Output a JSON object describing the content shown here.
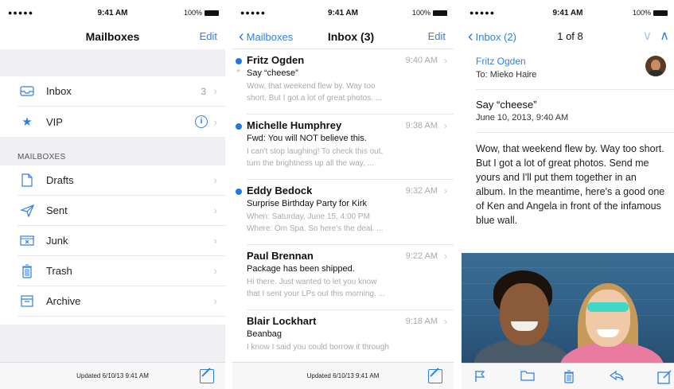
{
  "colors": {
    "accent": "#2f7fe0",
    "unread_dot": "#1f7ae8",
    "group_bg": "#efeff4"
  },
  "statusbar": {
    "carrier": "●●●●● ",
    "time": "9:41 AM",
    "battery": "100%"
  },
  "screen1": {
    "nav": {
      "title": "Mailboxes",
      "edit": "Edit"
    },
    "top_items": [
      {
        "icon": "inbox-icon",
        "label": "Inbox",
        "count": "3"
      },
      {
        "icon": "star-icon",
        "label": "VIP",
        "info": "i"
      }
    ],
    "section_header": "MAILBOXES",
    "items": [
      {
        "icon": "drafts-icon",
        "label": "Drafts"
      },
      {
        "icon": "sent-icon",
        "label": "Sent"
      },
      {
        "icon": "junk-icon",
        "label": "Junk"
      },
      {
        "icon": "trash-icon",
        "label": "Trash"
      },
      {
        "icon": "archive-icon",
        "label": "Archive"
      }
    ],
    "updated": "Updated 6/10/13 9:41 AM"
  },
  "screen2": {
    "nav": {
      "back": "Mailboxes",
      "title": "Inbox (3)",
      "edit": "Edit"
    },
    "messages": [
      {
        "from": "Fritz Ogden",
        "time": "9:40 AM",
        "subject": "Say “cheese”",
        "preview1": "Wow, that weekend flew by. Way too",
        "preview2": "short. But I got a lot of great photos. ...",
        "unread": true,
        "attachment": true
      },
      {
        "from": "Michelle Humphrey",
        "time": "9:38 AM",
        "subject": "Fwd: You will NOT believe this.",
        "preview1": "I can't stop laughing! To check this out,",
        "preview2": "turn the brightness up all the way, ...",
        "unread": true
      },
      {
        "from": "Eddy Bedock",
        "time": "9:32 AM",
        "subject": "Surprise Birthday Party for Kirk",
        "preview1": "When: Saturday, June 15, 4:00 PM",
        "preview2": "Where: Om Spa. So here's the deal. ...",
        "unread": true
      },
      {
        "from": "Paul Brennan",
        "time": "9:22 AM",
        "subject": "Package has been shipped.",
        "preview1": "Hi there. Just wanted to let you know",
        "preview2": "that I sent your LPs out this morning. ...",
        "unread": false
      },
      {
        "from": "Blair Lockhart",
        "time": "9:18 AM",
        "subject": "Beanbag",
        "preview1": "I know I said you could borrow it through",
        "preview2": "",
        "unread": false
      }
    ],
    "updated": "Updated 6/10/13 9:41 AM"
  },
  "screen3": {
    "nav": {
      "back": "Inbox (2)",
      "counter": "1 of 8"
    },
    "from": "Fritz Ogden",
    "to": "To: Mieko Haire",
    "subject": "Say “cheese”",
    "date": "June 10, 2013, 9:40 AM",
    "body": "Wow, that weekend flew by. Way too short. But I got a lot of great photos. Send me yours and I'll put them together in an album. In the meantime, here's a good one of Ken and Angela in front of the infamous blue wall.",
    "toolbar_icons": [
      "flag-icon",
      "folder-icon",
      "trash-icon",
      "reply-icon",
      "compose-icon"
    ]
  }
}
